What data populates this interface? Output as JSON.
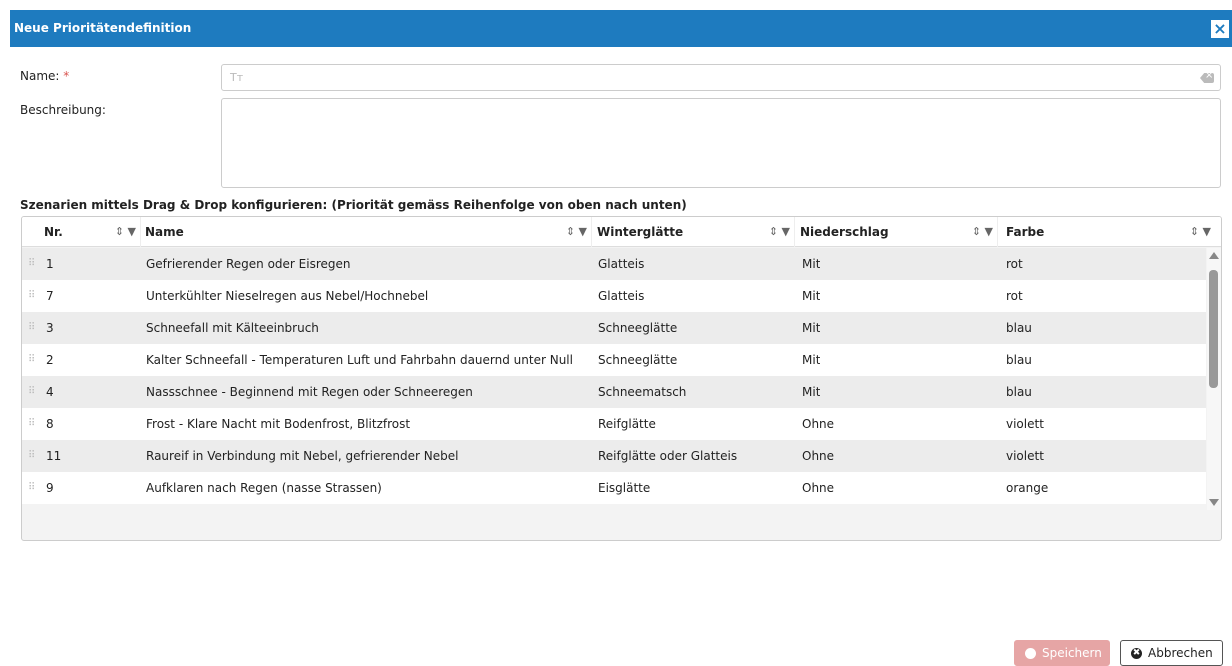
{
  "dialog": {
    "title": "Neue Prioritätendefinition",
    "close_icon": "×"
  },
  "form": {
    "name_label": "Name:",
    "required_marker": "*",
    "name_value": "",
    "name_type_icon": "Tт",
    "description_label": "Beschreibung:",
    "description_value": ""
  },
  "section_title": "Szenarien mittels Drag & Drop konfigurieren: (Priorität gemäss Reihenfolge von oben nach unten)",
  "grid": {
    "columns": [
      {
        "key": "nr",
        "label": "Nr."
      },
      {
        "key": "name",
        "label": "Name"
      },
      {
        "key": "winterglaette",
        "label": "Winterglätte"
      },
      {
        "key": "niederschlag",
        "label": "Niederschlag"
      },
      {
        "key": "farbe",
        "label": "Farbe"
      }
    ],
    "sort_filter_icon": "⇕ ▼",
    "drag_icon": "⠿",
    "rows": [
      {
        "nr": "1",
        "name": "Gefrierender Regen oder Eisregen",
        "winterglaette": "Glatteis",
        "niederschlag": "Mit",
        "farbe": "rot"
      },
      {
        "nr": "7",
        "name": "Unterkühlter Nieselregen aus Nebel/Hochnebel",
        "winterglaette": "Glatteis",
        "niederschlag": "Mit",
        "farbe": "rot"
      },
      {
        "nr": "3",
        "name": "Schneefall mit Kälteeinbruch",
        "winterglaette": "Schneeglätte",
        "niederschlag": "Mit",
        "farbe": "blau"
      },
      {
        "nr": "2",
        "name": "Kalter Schneefall - Temperaturen Luft und Fahrbahn dauernd unter Null",
        "winterglaette": "Schneeglätte",
        "niederschlag": "Mit",
        "farbe": "blau"
      },
      {
        "nr": "4",
        "name": "Nassschnee - Beginnend mit Regen oder Schneeregen",
        "winterglaette": "Schneematsch",
        "niederschlag": "Mit",
        "farbe": "blau"
      },
      {
        "nr": "8",
        "name": "Frost - Klare Nacht mit Bodenfrost, Blitzfrost",
        "winterglaette": "Reifglätte",
        "niederschlag": "Ohne",
        "farbe": "violett"
      },
      {
        "nr": "11",
        "name": "Raureif in Verbindung mit Nebel, gefrierender Nebel",
        "winterglaette": "Reifglätte oder Glatteis",
        "niederschlag": "Ohne",
        "farbe": "violett"
      },
      {
        "nr": "9",
        "name": "Aufklaren nach Regen (nasse Strassen)",
        "winterglaette": "Eisglätte",
        "niederschlag": "Ohne",
        "farbe": "orange"
      }
    ]
  },
  "buttons": {
    "save_label": "Speichern",
    "cancel_label": "Abbrechen",
    "cancel_icon": "✖"
  },
  "colors": {
    "titlebar": "#1e7bbf",
    "save_button": "#e6a5a5",
    "required": "#d9534f"
  }
}
